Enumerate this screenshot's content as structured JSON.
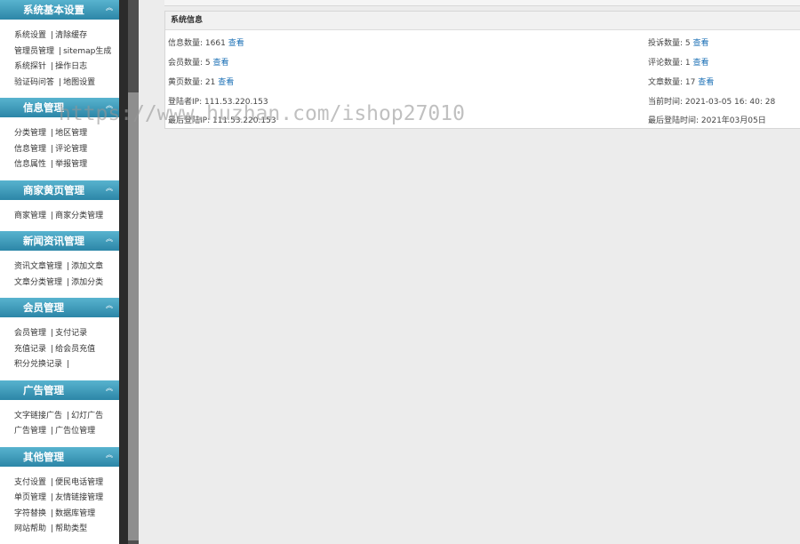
{
  "sidebar": {
    "groups": [
      {
        "title": "系统基本设置",
        "rows": [
          [
            "系统设置",
            "清除缓存"
          ],
          [
            "管理员管理",
            "sitemap生成"
          ],
          [
            "系统探针",
            "操作日志"
          ],
          [
            "验证码问答",
            "地图设置"
          ]
        ]
      },
      {
        "title": "信息管理",
        "rows": [
          [
            "分类管理",
            "地区管理"
          ],
          [
            "信息管理",
            "评论管理"
          ],
          [
            "信息属性",
            "举报管理"
          ]
        ]
      },
      {
        "title": "商家黄页管理",
        "rows": [
          [
            "商家管理",
            "商家分类管理"
          ]
        ]
      },
      {
        "title": "新闻资讯管理",
        "rows": [
          [
            "资讯文章管理",
            "添加文章"
          ],
          [
            "文章分类管理",
            "添加分类"
          ]
        ]
      },
      {
        "title": "会员管理",
        "rows": [
          [
            "会员管理",
            "支付记录"
          ],
          [
            "充值记录",
            "给会员充值"
          ],
          [
            "积分兑换记录",
            ""
          ]
        ]
      },
      {
        "title": "广告管理",
        "rows": [
          [
            "文字链接广告",
            "幻灯广告"
          ],
          [
            "广告管理",
            "广告位管理"
          ]
        ]
      },
      {
        "title": "其他管理",
        "rows": [
          [
            "支付设置",
            "便民电话管理"
          ],
          [
            "单页管理",
            "友情链接管理"
          ],
          [
            "字符替换",
            "数据库管理"
          ],
          [
            "网站帮助",
            "帮助类型"
          ]
        ]
      }
    ],
    "collapse_glyph": "︽"
  },
  "panel": {
    "title": "系统信息",
    "view_label": "查看",
    "items": {
      "info_count": "信息数量: 1661",
      "complaint_count": "投诉数量: 5",
      "member_count": "会员数量: 5",
      "comment_count": "评论数量: 1",
      "yellowpage_count": "黄页数量: 21",
      "article_count": "文章数量: 17",
      "login_ip": "登陆者IP: 111.53.220.153",
      "current_time": "当前时间: 2021-03-05 16: 40: 28",
      "last_login_ip": "最后登陆IP: 111.53.220.153",
      "last_login_time": "最后登陆时间: 2021年03月05日"
    }
  },
  "watermark": "https://www.huzhan.com/ishop27010",
  "colors": {
    "accent": "#2c86a7",
    "link": "#1a6fb5"
  }
}
